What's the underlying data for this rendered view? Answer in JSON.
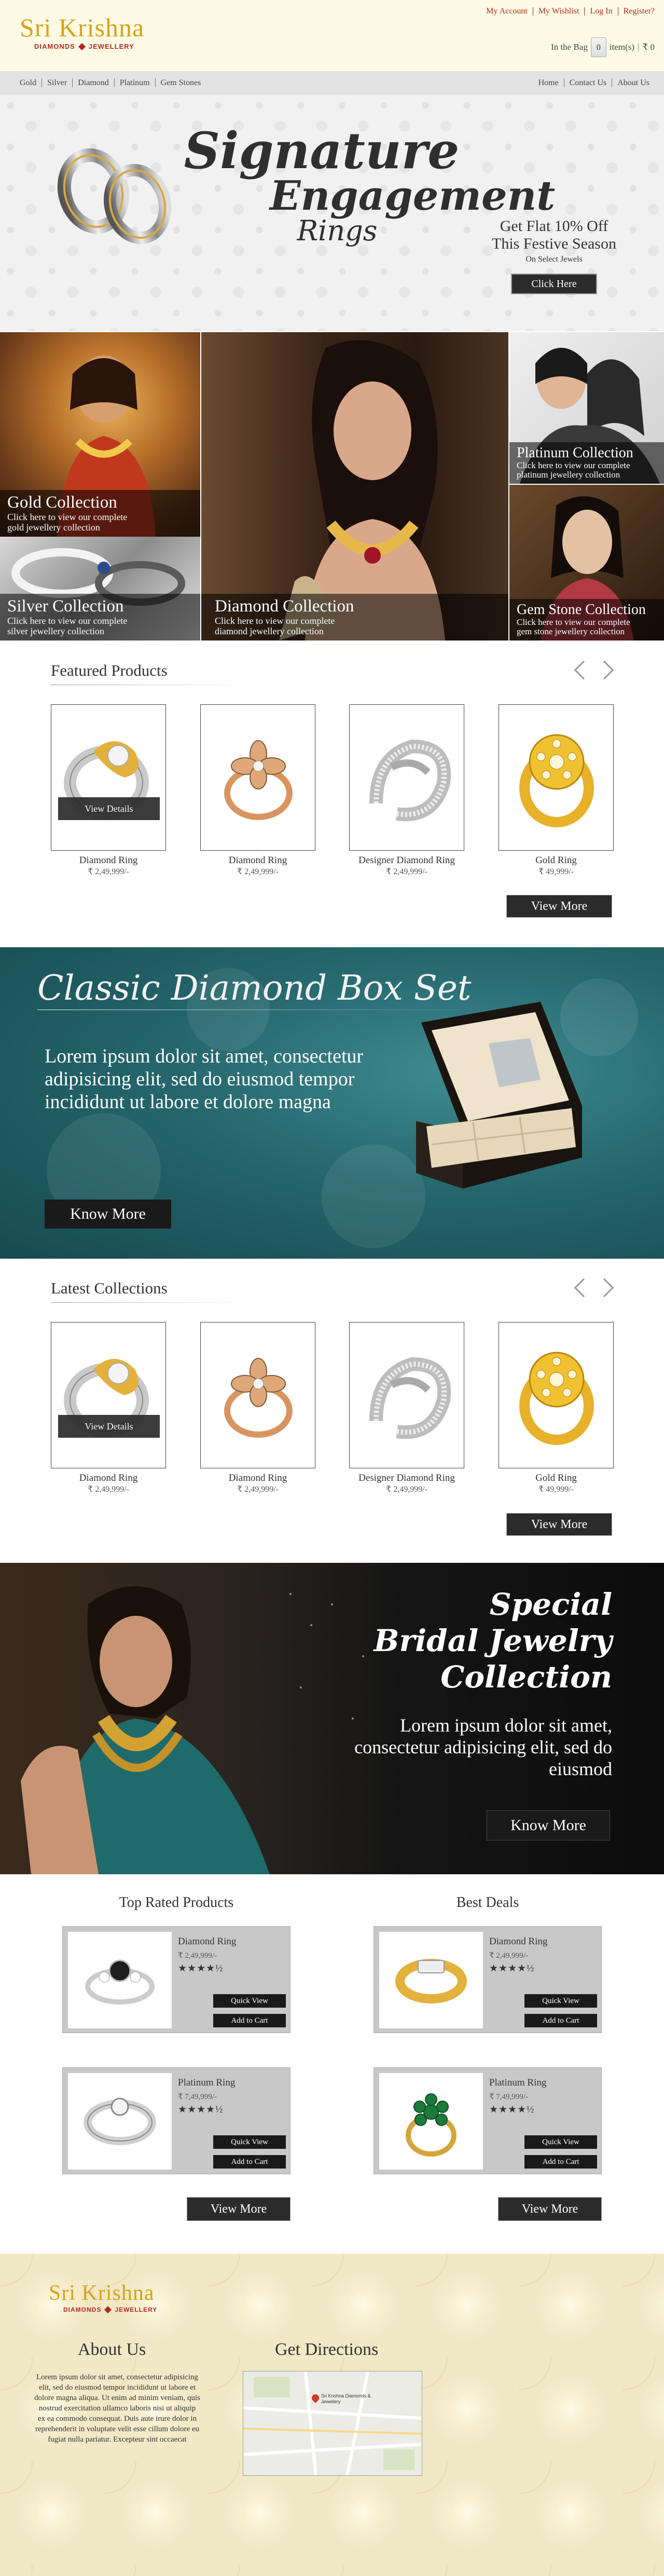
{
  "brand": {
    "name": "Sri Krishna",
    "tagline_left": "DIAMONDS",
    "tagline_right": "JEWELLERY"
  },
  "top_links": [
    "My Account",
    "My Wishlist",
    "Log In",
    "Register?"
  ],
  "bag": {
    "label": "In the Bag",
    "count": "0",
    "items_label": "item(s)",
    "total": "₹ 0"
  },
  "nav": {
    "left": [
      "Gold",
      "Silver",
      "Diamond",
      "Platinum",
      "Gem Stones"
    ],
    "right": [
      "Home",
      "Contact Us",
      "About Us"
    ]
  },
  "hero": {
    "title": [
      "Signature",
      "Engagement",
      "Rings"
    ],
    "offer_line1": "Get Flat 10% Off",
    "offer_line2": "This Festive Season",
    "offer_note": "On Select Jewels",
    "cta": "Click Here"
  },
  "collections": [
    {
      "title": "Gold Collection",
      "line1": "Click here to view our complete",
      "line2": "gold jewellery collection"
    },
    {
      "title": "Platinum Collection",
      "line1": "Click here to view our complete",
      "line2": "platinum jewellery collection"
    },
    {
      "title": "Silver Collection",
      "line1": "Click here to view our complete",
      "line2": "silver jewellery collection"
    },
    {
      "title": "Diamond Collection",
      "line1": "Click here to view our complete",
      "line2": "diamond jewellery collection"
    },
    {
      "title": "Gem Stone Collection",
      "line1": "Click here to view our complete",
      "line2": "gem stone jewellery collection"
    }
  ],
  "featured": {
    "title": "Featured Products",
    "view_details": "View Details",
    "view_more": "View More",
    "items": [
      {
        "name": "Diamond Ring",
        "price": "₹ 2,49,999/-"
      },
      {
        "name": "Diamond Ring",
        "price": "₹ 2,49,999/-"
      },
      {
        "name": "Designer Diamond Ring",
        "price": "₹ 2,49,999/-"
      },
      {
        "name": "Gold Ring",
        "price": "₹ 49,999/-"
      }
    ]
  },
  "teal_banner": {
    "title": "Classic Diamond Box Set",
    "text": "Lorem ipsum dolor sit amet, consectetur adipisicing elit, sed do eiusmod tempor incididunt ut labore et dolore magna",
    "cta": "Know More"
  },
  "latest": {
    "title": "Latest Collections",
    "view_details": "View Details",
    "view_more": "View More",
    "items": [
      {
        "name": "Diamond Ring",
        "price": "₹ 2,49,999/-"
      },
      {
        "name": "Diamond Ring",
        "price": "₹ 2,49,999/-"
      },
      {
        "name": "Designer Diamond Ring",
        "price": "₹ 2,49,999/-"
      },
      {
        "name": "Gold Ring",
        "price": "₹ 49,999/-"
      }
    ]
  },
  "bridal_banner": {
    "title": [
      "Special",
      "Bridal Jewelry",
      "Collection"
    ],
    "text": "Lorem ipsum dolor sit amet, consectetur adipisicing elit, sed do eiusmod",
    "cta": "Know More"
  },
  "top_rated": {
    "title": "Top Rated Products",
    "view_more": "View More",
    "items": [
      {
        "name": "Diamond Ring",
        "price": "₹ 2,49,999/-",
        "stars": "★★★★½",
        "quick_view": "Quick View",
        "add_to_cart": "Add to Cart"
      },
      {
        "name": "Platinum Ring",
        "price": "₹ 7,49,999/-",
        "stars": "★★★★½",
        "quick_view": "Quick View",
        "add_to_cart": "Add to Cart"
      }
    ]
  },
  "best_deals": {
    "title": "Best Deals",
    "view_more": "View More",
    "items": [
      {
        "name": "Diamond Ring",
        "price": "₹ 2,49,999/-",
        "stars": "★★★★½",
        "quick_view": "Quick View",
        "add_to_cart": "Add to Cart"
      },
      {
        "name": "Platinum Ring",
        "price": "₹ 7,49,999/-",
        "stars": "★★★★½",
        "quick_view": "Quick View",
        "add_to_cart": "Add to Cart"
      }
    ]
  },
  "footer": {
    "about_title": "About Us",
    "about_text": "Lorem ipsum dolor sit amet, consectetur adipisicing elit, sed do eiusmod tempor incididunt ut labore et dolore magna aliqua. Ut enim ad minim veniam, quis nostrud exercitation ullamco laboris nisi ut aliquip ex ea commodo consequat. Duis aute irure dolor in reprehenderit in voluptate velit esse cillum dolore eu fugiat nulla pariatur. Excepteur sint occaecat",
    "directions_title": "Get Directions",
    "map_label": "Sri Krishna Diamonds & Jewellery"
  },
  "colors": {
    "brand_gold": "#d6a31a",
    "brand_red": "#b12a1c",
    "header_bg": "#fdfbe6",
    "button_dark": "#2b2b2b",
    "teal": "#24666c"
  }
}
